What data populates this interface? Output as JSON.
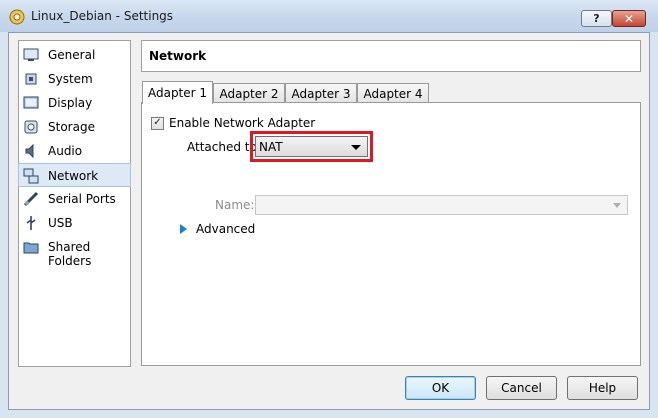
{
  "window": {
    "title": "Linux_Debian - Settings",
    "help_glyph": "?",
    "close_glyph": "✕"
  },
  "sidebar": {
    "items": [
      {
        "label": "General",
        "icon": "general-icon"
      },
      {
        "label": "System",
        "icon": "system-icon"
      },
      {
        "label": "Display",
        "icon": "display-icon"
      },
      {
        "label": "Storage",
        "icon": "storage-icon"
      },
      {
        "label": "Audio",
        "icon": "audio-icon"
      },
      {
        "label": "Network",
        "icon": "network-icon",
        "selected": true
      },
      {
        "label": "Serial Ports",
        "icon": "serial-ports-icon"
      },
      {
        "label": "USB",
        "icon": "usb-icon"
      },
      {
        "label": "Shared Folders",
        "icon": "shared-folders-icon"
      }
    ]
  },
  "page": {
    "title": "Network"
  },
  "tabs": [
    {
      "label": "Adapter 1",
      "active": true
    },
    {
      "label": "Adapter 2"
    },
    {
      "label": "Adapter 3"
    },
    {
      "label": "Adapter 4"
    }
  ],
  "adapter": {
    "enable_label": "Enable Network Adapter",
    "enable_checked": true,
    "check_glyph": "✓",
    "attached_label": "Attached to:",
    "attached_value": "NAT",
    "name_label": "Name:",
    "name_value": "",
    "advanced_label": "Advanced"
  },
  "buttons": {
    "ok": "OK",
    "cancel": "Cancel",
    "help": "Help"
  },
  "colors": {
    "highlight": "#e2171f",
    "selection": "#dde9f6",
    "advanced_arrow": "#1e7fd8"
  }
}
